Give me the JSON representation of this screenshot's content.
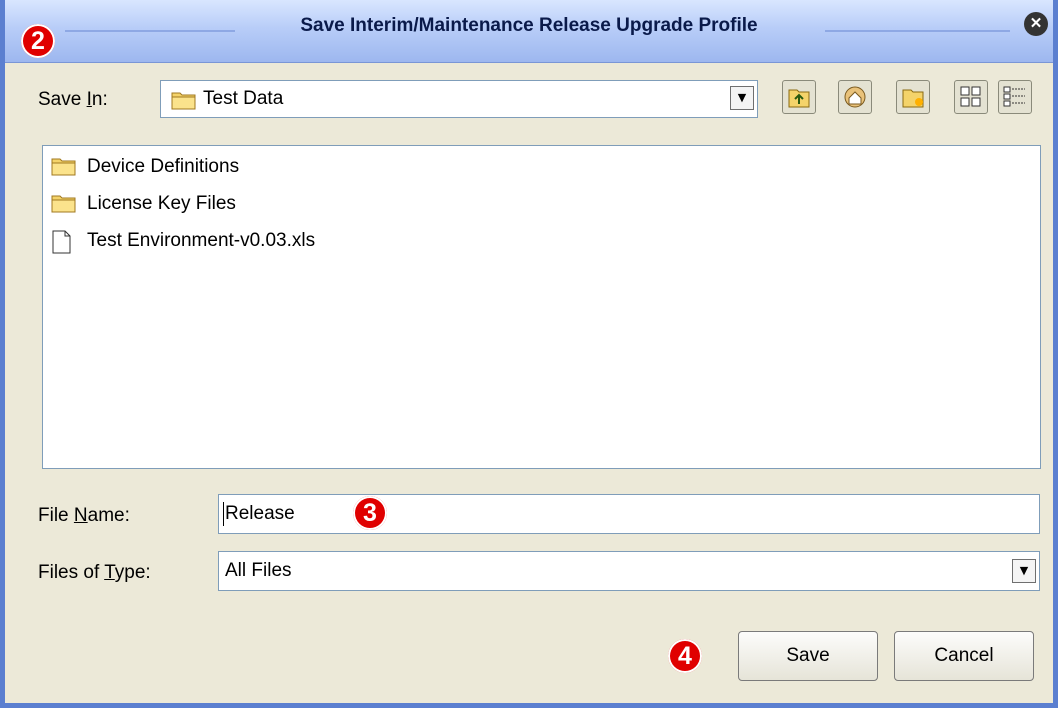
{
  "window": {
    "title": "Save Interim/Maintenance Release Upgrade Profile",
    "close_icon": "close-icon"
  },
  "annotations": {
    "badge_2": "2",
    "badge_3": "3",
    "badge_4": "4"
  },
  "save_in": {
    "label_before": "Save ",
    "label_mnemonic": "I",
    "label_after": "n:",
    "value": "Test Data",
    "folder_icon": "folder-icon"
  },
  "toolbar": {
    "icons": [
      "up-folder-icon",
      "home-icon",
      "new-folder-icon",
      "list-view-icon",
      "details-view-icon"
    ]
  },
  "file_list": [
    {
      "name": "Device Definitions",
      "icon": "folder-icon"
    },
    {
      "name": "License Key Files",
      "icon": "folder-icon"
    },
    {
      "name": "Test Environment-v0.03.xls",
      "icon": "file-icon"
    }
  ],
  "file_name": {
    "label_before": "File ",
    "label_mnemonic": "N",
    "label_after": "ame:",
    "value": "Release"
  },
  "file_type": {
    "label_before": "Files of ",
    "label_mnemonic": "T",
    "label_after": "ype:",
    "value": "All Files"
  },
  "buttons": {
    "save": "Save",
    "cancel": "Cancel"
  },
  "colors": {
    "badge": "#e00000",
    "titlebar": "#b8cdf8",
    "dialog_bg": "#ece9d8"
  }
}
